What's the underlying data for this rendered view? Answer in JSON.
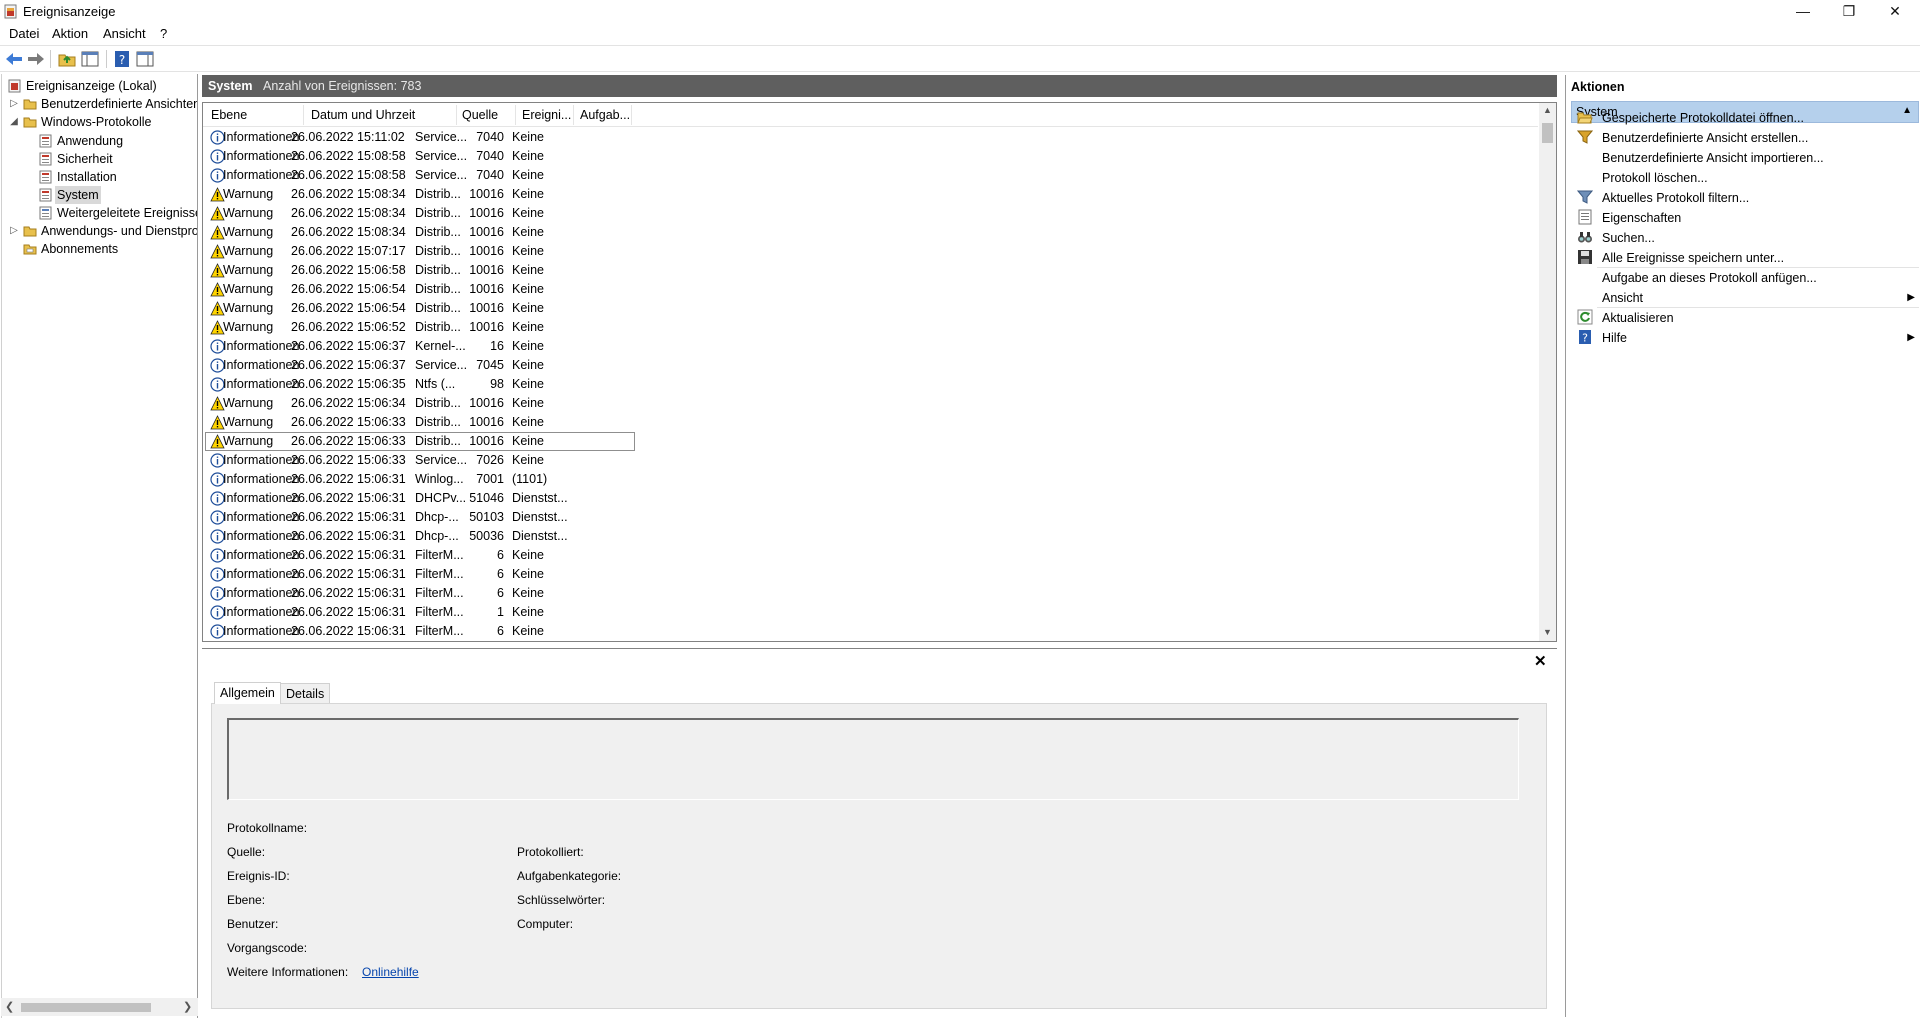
{
  "window": {
    "title": "Ereignisanzeige"
  },
  "menu": [
    "Datei",
    "Aktion",
    "Ansicht",
    "?"
  ],
  "tree": {
    "root": "Ereignisanzeige (Lokal)",
    "custom_views": "Benutzerdefinierte Ansichten",
    "windows_logs": "Windows-Protokolle",
    "logs": [
      "Anwendung",
      "Sicherheit",
      "Installation",
      "System",
      "Weitergeleitete Ereignisse"
    ],
    "app_service_logs": "Anwendungs- und Dienstprotokolle",
    "subscriptions": "Abonnements",
    "selected": "System"
  },
  "list_header": {
    "name": "System",
    "count_label": "Anzahl von Ereignissen: 783"
  },
  "columns": [
    "Ebene",
    "Datum und Uhrzeit",
    "Quelle",
    "Ereigni...",
    "Aufgab..."
  ],
  "events": [
    {
      "level": "Informationen",
      "icon": "info",
      "date": "26.06.2022 15:11:02",
      "source": "Service...",
      "id": "7040",
      "task": "Keine"
    },
    {
      "level": "Informationen",
      "icon": "info",
      "date": "26.06.2022 15:08:58",
      "source": "Service...",
      "id": "7040",
      "task": "Keine"
    },
    {
      "level": "Informationen",
      "icon": "info",
      "date": "26.06.2022 15:08:58",
      "source": "Service...",
      "id": "7040",
      "task": "Keine"
    },
    {
      "level": "Warnung",
      "icon": "warning",
      "date": "26.06.2022 15:08:34",
      "source": "Distrib...",
      "id": "10016",
      "task": "Keine"
    },
    {
      "level": "Warnung",
      "icon": "warning",
      "date": "26.06.2022 15:08:34",
      "source": "Distrib...",
      "id": "10016",
      "task": "Keine"
    },
    {
      "level": "Warnung",
      "icon": "warning",
      "date": "26.06.2022 15:08:34",
      "source": "Distrib...",
      "id": "10016",
      "task": "Keine"
    },
    {
      "level": "Warnung",
      "icon": "warning",
      "date": "26.06.2022 15:07:17",
      "source": "Distrib...",
      "id": "10016",
      "task": "Keine"
    },
    {
      "level": "Warnung",
      "icon": "warning",
      "date": "26.06.2022 15:06:58",
      "source": "Distrib...",
      "id": "10016",
      "task": "Keine"
    },
    {
      "level": "Warnung",
      "icon": "warning",
      "date": "26.06.2022 15:06:54",
      "source": "Distrib...",
      "id": "10016",
      "task": "Keine"
    },
    {
      "level": "Warnung",
      "icon": "warning",
      "date": "26.06.2022 15:06:54",
      "source": "Distrib...",
      "id": "10016",
      "task": "Keine"
    },
    {
      "level": "Warnung",
      "icon": "warning",
      "date": "26.06.2022 15:06:52",
      "source": "Distrib...",
      "id": "10016",
      "task": "Keine"
    },
    {
      "level": "Informationen",
      "icon": "info",
      "date": "26.06.2022 15:06:37",
      "source": "Kernel-...",
      "id": "16",
      "task": "Keine"
    },
    {
      "level": "Informationen",
      "icon": "info",
      "date": "26.06.2022 15:06:37",
      "source": "Service...",
      "id": "7045",
      "task": "Keine"
    },
    {
      "level": "Informationen",
      "icon": "info",
      "date": "26.06.2022 15:06:35",
      "source": "Ntfs (...",
      "id": "98",
      "task": "Keine"
    },
    {
      "level": "Warnung",
      "icon": "warning",
      "date": "26.06.2022 15:06:34",
      "source": "Distrib...",
      "id": "10016",
      "task": "Keine"
    },
    {
      "level": "Warnung",
      "icon": "warning",
      "date": "26.06.2022 15:06:33",
      "source": "Distrib...",
      "id": "10016",
      "task": "Keine"
    },
    {
      "level": "Warnung",
      "icon": "warning",
      "date": "26.06.2022 15:06:33",
      "source": "Distrib...",
      "id": "10016",
      "task": "Keine",
      "focused": true
    },
    {
      "level": "Informationen",
      "icon": "info",
      "date": "26.06.2022 15:06:33",
      "source": "Service...",
      "id": "7026",
      "task": "Keine"
    },
    {
      "level": "Informationen",
      "icon": "info",
      "date": "26.06.2022 15:06:31",
      "source": "Winlog...",
      "id": "7001",
      "task": "(1101)"
    },
    {
      "level": "Informationen",
      "icon": "info",
      "date": "26.06.2022 15:06:31",
      "source": "DHCPv...",
      "id": "51046",
      "task": "Dienstst..."
    },
    {
      "level": "Informationen",
      "icon": "info",
      "date": "26.06.2022 15:06:31",
      "source": "Dhcp-...",
      "id": "50103",
      "task": "Dienstst..."
    },
    {
      "level": "Informationen",
      "icon": "info",
      "date": "26.06.2022 15:06:31",
      "source": "Dhcp-...",
      "id": "50036",
      "task": "Dienstst..."
    },
    {
      "level": "Informationen",
      "icon": "info",
      "date": "26.06.2022 15:06:31",
      "source": "FilterM...",
      "id": "6",
      "task": "Keine"
    },
    {
      "level": "Informationen",
      "icon": "info",
      "date": "26.06.2022 15:06:31",
      "source": "FilterM...",
      "id": "6",
      "task": "Keine"
    },
    {
      "level": "Informationen",
      "icon": "info",
      "date": "26.06.2022 15:06:31",
      "source": "FilterM...",
      "id": "6",
      "task": "Keine"
    },
    {
      "level": "Informationen",
      "icon": "info",
      "date": "26.06.2022 15:06:31",
      "source": "FilterM...",
      "id": "1",
      "task": "Keine"
    },
    {
      "level": "Informationen",
      "icon": "info",
      "date": "26.06.2022 15:06:31",
      "source": "FilterM...",
      "id": "6",
      "task": "Keine"
    }
  ],
  "detail": {
    "tabs": [
      "Allgemein",
      "Details"
    ],
    "active_tab": "Allgemein",
    "fields": {
      "protokollname": "Protokollname:",
      "quelle": "Quelle:",
      "ereignis_id": "Ereignis-ID:",
      "ebene": "Ebene:",
      "benutzer": "Benutzer:",
      "vorgangscode": "Vorgangscode:",
      "weitere_info": "Weitere Informationen:",
      "protokolliert": "Protokolliert:",
      "aufgabenkategorie": "Aufgabenkategorie:",
      "schluesselwoerter": "Schlüsselwörter:",
      "computer": "Computer:"
    },
    "help_link": "Onlinehilfe"
  },
  "actions": {
    "title": "Aktionen",
    "section": "System",
    "items": [
      {
        "label": "Gespeicherte Protokolldatei öffnen...",
        "icon": "open-folder-icon"
      },
      {
        "label": "Benutzerdefinierte Ansicht erstellen...",
        "icon": "filter-create-icon"
      },
      {
        "label": "Benutzerdefinierte Ansicht importieren...",
        "icon": ""
      },
      {
        "label": "Protokoll löschen...",
        "icon": ""
      },
      {
        "label": "Aktuelles Protokoll filtern...",
        "icon": "filter-icon"
      },
      {
        "label": "Eigenschaften",
        "icon": "properties-icon"
      },
      {
        "label": "Suchen...",
        "icon": "binoculars-icon"
      },
      {
        "label": "Alle Ereignisse speichern unter...",
        "icon": "save-icon"
      },
      {
        "label": "Aufgabe an dieses Protokoll anfügen...",
        "icon": ""
      },
      {
        "label": "Ansicht",
        "icon": "",
        "submenu": true
      },
      {
        "label": "Aktualisieren",
        "icon": "refresh-icon"
      },
      {
        "label": "Hilfe",
        "icon": "help-icon",
        "submenu": true
      }
    ]
  },
  "colors": {
    "header_dark": "#5f5f5f",
    "section_blue": "#b5d0ec",
    "warning_yellow": "#ffd400",
    "info_blue": "#1f4e9a",
    "link": "#0645ad"
  }
}
